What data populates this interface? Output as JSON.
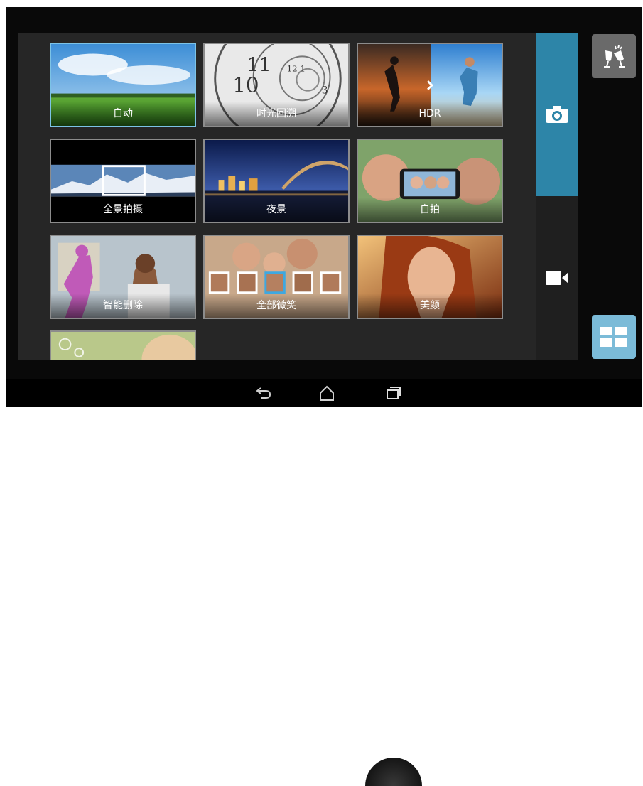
{
  "modes": [
    {
      "label": "自动",
      "selected": true
    },
    {
      "label": "时光回溯",
      "selected": false
    },
    {
      "label": "HDR",
      "selected": false
    },
    {
      "label": "全景拍摄",
      "selected": false
    },
    {
      "label": "夜景",
      "selected": false
    },
    {
      "label": "自拍",
      "selected": false
    },
    {
      "label": "智能删除",
      "selected": false
    },
    {
      "label": "全部微笑",
      "selected": false
    },
    {
      "label": "美颜",
      "selected": false
    },
    {
      "label": "",
      "selected": false
    }
  ],
  "side_tabs": {
    "active": "photo",
    "photo_icon": "camera-icon",
    "video_icon": "video-camera-icon"
  },
  "buttons": {
    "top_icon": "toast-glasses-icon",
    "bottom_icon": "grid-layout-icon"
  },
  "navbar": {
    "back_icon": "back-icon",
    "home_icon": "home-icon",
    "recent_icon": "recent-apps-icon"
  },
  "colors": {
    "accent": "#2d85a8",
    "selected_border": "#7cc3e6",
    "grid_button": "#7bbbd8"
  }
}
